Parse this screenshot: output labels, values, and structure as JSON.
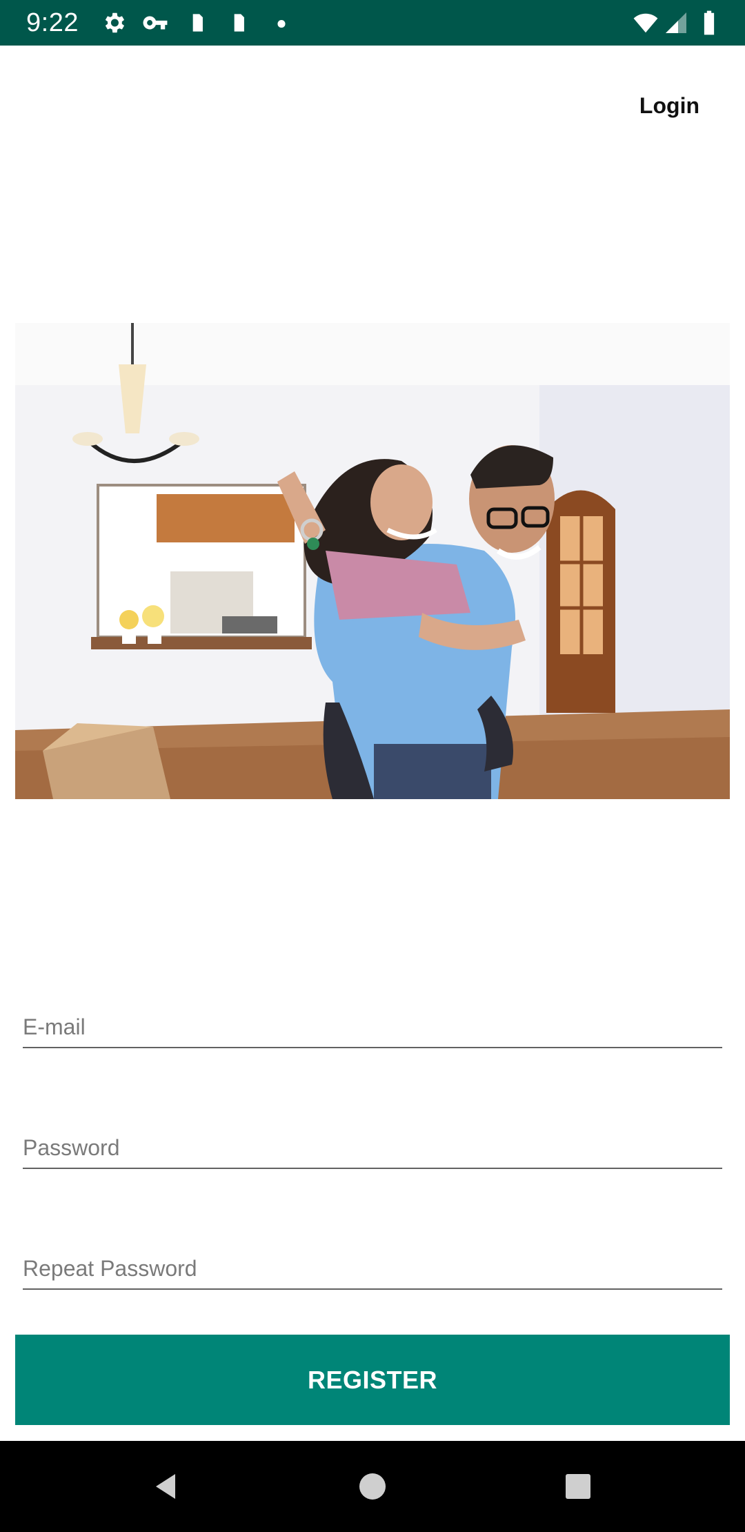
{
  "status_bar": {
    "time": "9:22",
    "icons": [
      "gear-icon",
      "key-icon",
      "sim-card-icon",
      "sim-card-icon",
      "dot-icon",
      "wifi-icon",
      "signal-icon",
      "battery-icon"
    ],
    "background": "#00574b"
  },
  "header": {
    "login_label": "Login"
  },
  "hero": {
    "image": "couple-holding-keys-in-new-home-photo"
  },
  "form": {
    "email_placeholder": "E-mail",
    "email_value": "",
    "password_placeholder": "Password",
    "password_value": "",
    "repeat_password_placeholder": "Repeat Password",
    "repeat_password_value": "",
    "register_label": "REGISTER"
  },
  "colors": {
    "accent": "#008577",
    "status_bar": "#00574b",
    "navigation_bar": "#000000"
  },
  "navigation_bar": {
    "buttons": [
      "back-icon",
      "home-icon",
      "recents-icon"
    ]
  }
}
